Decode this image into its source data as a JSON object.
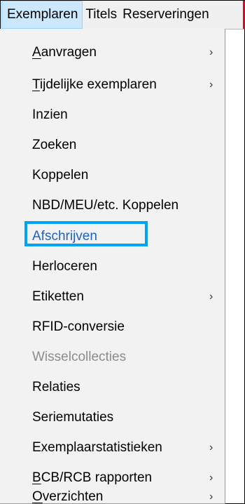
{
  "menubar": {
    "items": [
      {
        "label": "Exemplaren"
      },
      {
        "label": "Titels"
      },
      {
        "label": "Reserveringen"
      }
    ]
  },
  "menu": {
    "items": [
      {
        "label": "Aanvragen",
        "mnemonic": "A",
        "rest": "anvragen",
        "submenu": true
      },
      {
        "label": "Tijdelijke exemplaren",
        "mnemonic": "T",
        "rest": "ijdelijke exemplaren",
        "submenu": true
      },
      {
        "label": "Inzien"
      },
      {
        "label": "Zoeken"
      },
      {
        "label": "Koppelen"
      },
      {
        "label": "NBD/MEU/etc. Koppelen"
      },
      {
        "label": "Afschrijven",
        "highlighted": true
      },
      {
        "label": "Herloceren"
      },
      {
        "label": "Etiketten",
        "submenu": true
      },
      {
        "label": "RFID-conversie"
      },
      {
        "label": "Wisselcollecties",
        "disabled": true
      },
      {
        "label": "Relaties"
      },
      {
        "label": "Seriemutaties"
      },
      {
        "label": "Exemplaarstatistieken",
        "submenu": true
      },
      {
        "label": "BCB/RCB rapporten",
        "mnemonic": "B",
        "rest": "CB/RCB rapporten",
        "submenu": true
      },
      {
        "label": "Overzichten",
        "mnemonic": "O",
        "rest": "verzichten",
        "submenu": true
      }
    ],
    "chevron": "›"
  }
}
